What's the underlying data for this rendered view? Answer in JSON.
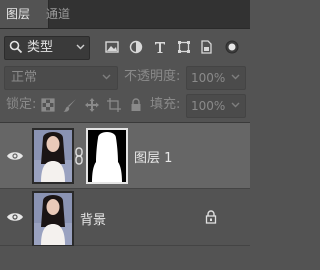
{
  "tabs": {
    "layers": "图层",
    "channels": "通道"
  },
  "filter": {
    "kind_label": "类型",
    "icons": [
      "image-filter-icon",
      "adjustment-filter-icon",
      "type-filter-icon",
      "shape-filter-icon",
      "smart-object-filter-icon"
    ]
  },
  "blend": {
    "mode": "正常",
    "opacity_label": "不透明度:",
    "opacity_value": "100%"
  },
  "lock": {
    "label": "锁定:",
    "icons": [
      "lock-transparent-icon",
      "lock-image-icon",
      "lock-position-icon",
      "lock-artboard-icon",
      "lock-all-icon"
    ],
    "fill_label": "填充:",
    "fill_value": "100%"
  },
  "layers": [
    {
      "name": "图层 1",
      "selected": true,
      "has_mask": true
    },
    {
      "name": "背景",
      "selected": false,
      "locked": true
    }
  ],
  "colors": {
    "panel_bg": "#535353",
    "tab_bg": "#323232",
    "selected_layer_bg": "#666666",
    "text": "#e8e8e8",
    "disabled_text": "#8a8a8a"
  }
}
